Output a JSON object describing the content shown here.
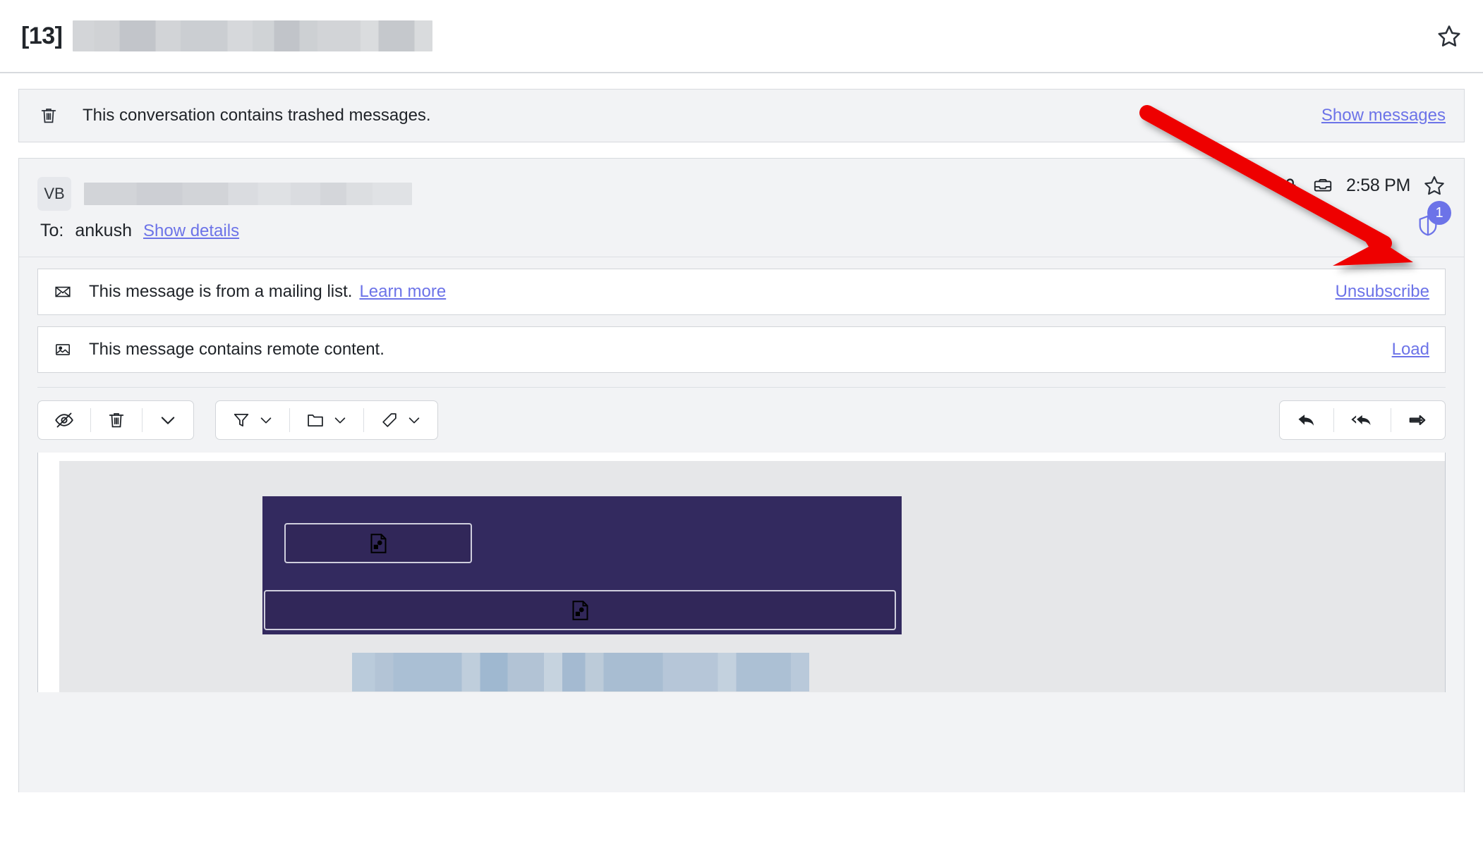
{
  "conversation": {
    "count_label": "[13]",
    "subject_redacted": true,
    "star_icon": "star-outline-icon"
  },
  "trash_notice": {
    "icon": "trash-icon",
    "text": "This conversation contains trashed messages.",
    "action_label": "Show messages"
  },
  "message": {
    "avatar_initials": "VB",
    "sender_redacted": true,
    "to_label": "To:",
    "to_value": "ankush",
    "show_details_label": "Show details",
    "time": "2:58 PM",
    "icons": {
      "encryption": "lock-icon",
      "folder": "inbox-icon",
      "star": "star-outline-icon",
      "tracker_shield": "shield-icon"
    },
    "tracker_badge_count": "1"
  },
  "notices": [
    {
      "icon": "envelope-icon",
      "text": "This message is from a mailing list.",
      "inline_link": "Learn more",
      "action_label": "Unsubscribe"
    },
    {
      "icon": "remote-image-icon",
      "text": "This message contains remote content.",
      "inline_link": "",
      "action_label": "Load"
    }
  ],
  "toolbar": {
    "left_group": [
      {
        "name": "mark-unread-button",
        "icon": "eye-slash-icon"
      },
      {
        "name": "delete-button",
        "icon": "trash-icon"
      },
      {
        "name": "more-actions-button",
        "icon": "chevron-down-icon"
      }
    ],
    "middle_group": [
      {
        "name": "filter-button",
        "icon": "funnel-icon",
        "caret": "chevron-down-icon"
      },
      {
        "name": "move-to-folder-button",
        "icon": "folder-icon",
        "caret": "chevron-down-icon"
      },
      {
        "name": "tag-button",
        "icon": "tag-icon",
        "caret": "chevron-down-icon"
      }
    ],
    "right_group": [
      {
        "name": "reply-button",
        "icon": "reply-arrow-icon"
      },
      {
        "name": "reply-all-button",
        "icon": "reply-all-arrow-icon"
      },
      {
        "name": "forward-button",
        "icon": "forward-arrow-icon"
      }
    ]
  },
  "email_body": {
    "banner_color": "#332a5f",
    "banner_box_border": "#cfcedd",
    "placeholder_icon": "broken-image-icon",
    "blurred_content": true
  },
  "annotation": {
    "arrow_color": "#ee0000",
    "points_to": "shield-icon"
  },
  "colors": {
    "link": "#6c73e8",
    "badge": "#6c73e8",
    "text": "#1f2328",
    "panel_bg": "#f2f3f5",
    "border": "#d7dade"
  }
}
